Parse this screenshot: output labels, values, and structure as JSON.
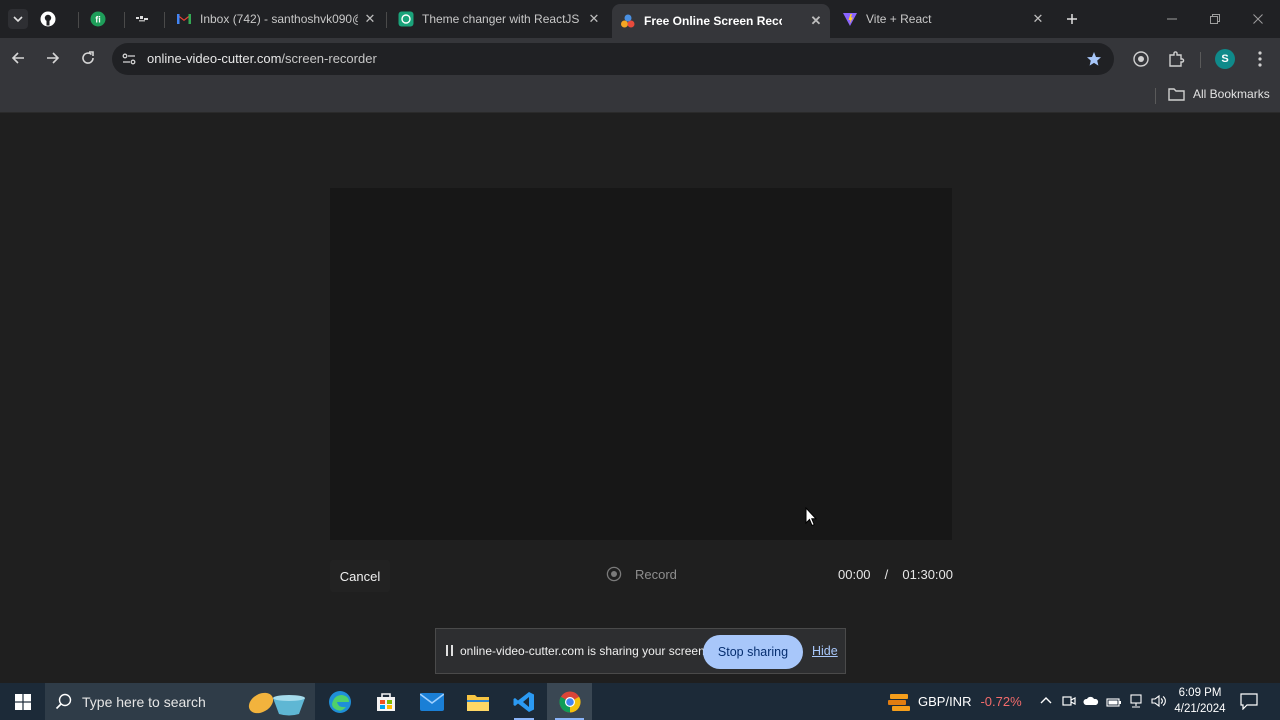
{
  "tabs": {
    "items": [
      {
        "title": "",
        "icon": "github-icon"
      },
      {
        "title": "",
        "icon": "green-app-icon"
      },
      {
        "title": "",
        "icon": "dots-logo-icon"
      },
      {
        "title": "Inbox (742) - santhoshvk090@",
        "icon": "gmail-icon"
      },
      {
        "title": "Theme changer with ReactJS",
        "icon": "chatgpt-icon"
      },
      {
        "title": "Free Online Screen Recorder",
        "icon": "video-cutter-icon",
        "active": true
      },
      {
        "title": "Vite + React",
        "icon": "vite-icon"
      }
    ]
  },
  "omnibox": {
    "domain": "online-video-cutter.com",
    "path": "/screen-recorder"
  },
  "profile": {
    "initial": "S"
  },
  "bookmarks": {
    "all_label": "All Bookmarks"
  },
  "recorder": {
    "cancel_label": "Cancel",
    "record_label": "Record",
    "elapsed": "00:00",
    "separator": "/",
    "limit": "01:30:00"
  },
  "share": {
    "message": "online-video-cutter.com is sharing your screen.",
    "stop_label": "Stop sharing",
    "hide_label": "Hide"
  },
  "taskbar": {
    "search_placeholder": "Type here to search",
    "ticker_label": "GBP/INR",
    "ticker_change": "-0.72%",
    "time": "6:09 PM",
    "date": "4/21/2024"
  },
  "colors": {
    "accent_button": "#a8c7fa",
    "ticker_negative": "#f26b6b"
  }
}
